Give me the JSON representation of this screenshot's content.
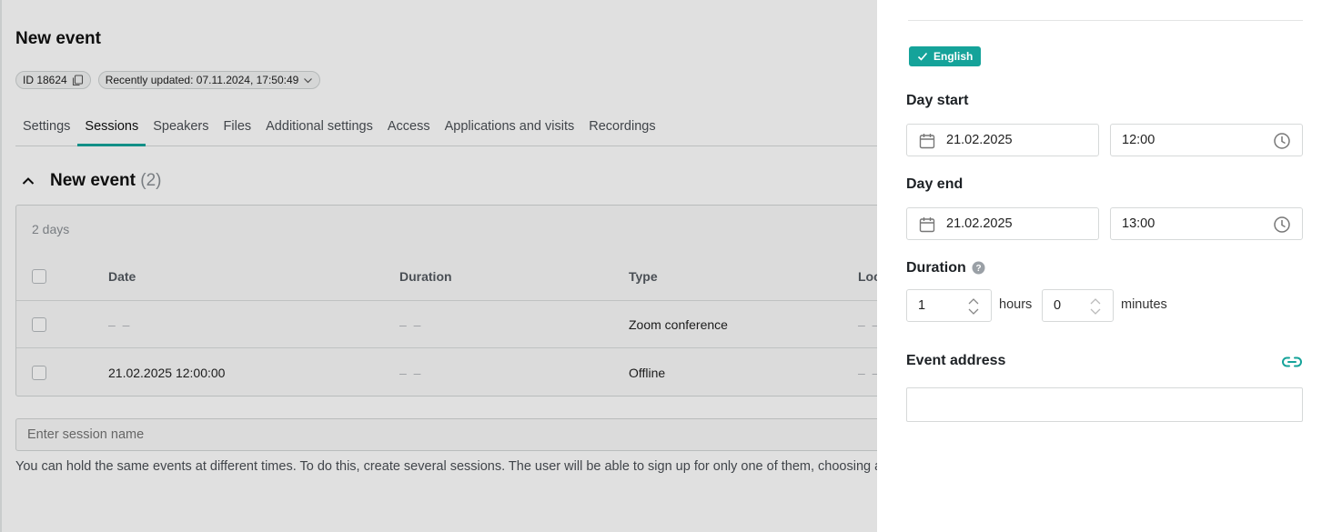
{
  "page": {
    "title": "New event",
    "id_chip": "ID 18624",
    "updated_chip": "Recently updated: 07.11.2024, 17:50:49",
    "tabs": [
      {
        "label": "Settings"
      },
      {
        "label": "Sessions"
      },
      {
        "label": "Speakers"
      },
      {
        "label": "Files"
      },
      {
        "label": "Additional settings"
      },
      {
        "label": "Access"
      },
      {
        "label": "Applications and visits"
      },
      {
        "label": "Recordings"
      }
    ],
    "active_tab": "Sessions",
    "section_name": "New event",
    "section_count": "(2)",
    "days_label": "2 days",
    "table": {
      "headers": [
        "Date",
        "Duration",
        "Type",
        "Loc"
      ],
      "rows": [
        {
          "date": "– –",
          "duration": "– –",
          "type": "Zoom conference",
          "loc": "– –"
        },
        {
          "date": "21.02.2025 12:00:00",
          "duration": "– –",
          "type": "Offline",
          "loc": "– –"
        }
      ]
    },
    "session_placeholder": "Enter session name",
    "hint": "You can hold the same events at different times. To do this, create several sessions. The user will be able to sign up for only one of them, choosing a conv"
  },
  "panel": {
    "language_badge": "English",
    "day_start_label": "Day start",
    "day_start_date": "21.02.2025",
    "day_start_time": "12:00",
    "day_end_label": "Day end",
    "day_end_date": "21.02.2025",
    "day_end_time": "13:00",
    "duration_label": "Duration",
    "duration_hours": "1",
    "hours_unit": "hours",
    "duration_minutes": "0",
    "minutes_unit": "minutes",
    "event_address_label": "Event address",
    "event_address_value": ""
  },
  "colors": {
    "accent": "#15a39a",
    "overlay": "rgba(0,0,0,0.12)"
  },
  "icons": {
    "copy": "copy-icon",
    "chevron": "chevron-down-icon",
    "collapse": "chevron-up-icon",
    "calendar": "calendar-icon",
    "clock": "clock-icon",
    "check": "check-icon",
    "help": "help-icon",
    "link": "link-icon"
  }
}
